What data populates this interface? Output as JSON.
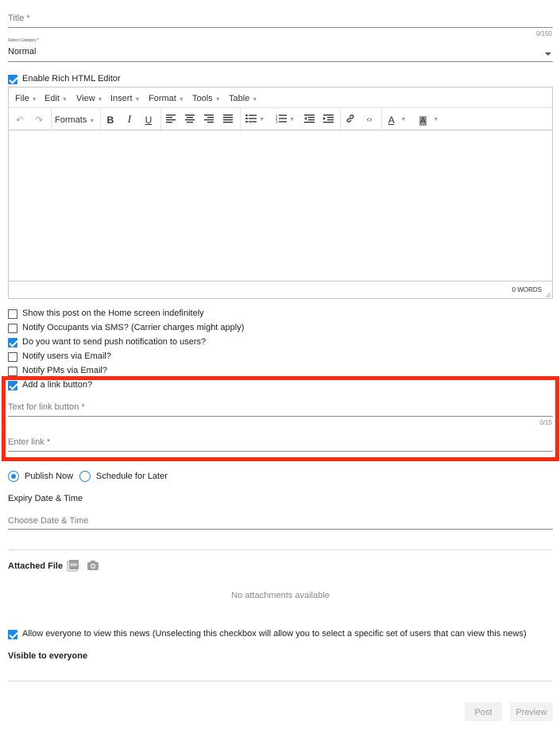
{
  "title_field": {
    "placeholder": "Title *",
    "counter": "0/150"
  },
  "category": {
    "label": "Select Category *",
    "value": "Normal"
  },
  "rich_editor_toggle": {
    "label": "Enable Rich HTML Editor",
    "checked": true
  },
  "editor": {
    "menus": [
      "File",
      "Edit",
      "View",
      "Insert",
      "Format",
      "Tools",
      "Table"
    ],
    "formats_label": "Formats",
    "toolbar_icons": [
      "undo-icon",
      "redo-icon",
      "bold-icon",
      "italic-icon",
      "underline-icon",
      "align-left-icon",
      "align-center-icon",
      "align-right-icon",
      "align-justify-icon",
      "bullet-list-icon",
      "numbered-list-icon",
      "outdent-icon",
      "indent-icon",
      "link-icon",
      "code-icon",
      "text-color-icon",
      "background-color-icon"
    ],
    "word_count": "0 WORDS"
  },
  "options": [
    {
      "label": "Show this post on the Home screen indefinitely",
      "checked": false
    },
    {
      "label": "Notify Occupants via SMS? (Carrier charges might apply)",
      "checked": false
    },
    {
      "label": "Do you want to send push notification to users?",
      "checked": true
    },
    {
      "label": "Notify users via Email?",
      "checked": false
    },
    {
      "label": "Notify PMs via Email?",
      "checked": false
    },
    {
      "label": "Add a link button?",
      "checked": true
    }
  ],
  "link_button": {
    "text_placeholder": "Text for link button *",
    "text_counter": "0/15",
    "link_placeholder": "Enter link *"
  },
  "publish": {
    "now_label": "Publish Now",
    "later_label": "Schedule for Later",
    "selected": "now"
  },
  "expiry": {
    "label": "Expiry Date & Time",
    "placeholder": "Choose Date & Time"
  },
  "attachments": {
    "label": "Attached File",
    "empty_text": "No attachments available"
  },
  "visibility": {
    "allow_label": "Allow everyone to view this news (Unselecting this checkbox will allow you to select a specific set of users that can view this news)",
    "allow_checked": true,
    "status": "Visible to everyone"
  },
  "actions": {
    "post_label": "Post",
    "preview_label": "Preview"
  },
  "colors": {
    "accent": "#1e88e5",
    "highlight_border": "#ff2a10"
  }
}
